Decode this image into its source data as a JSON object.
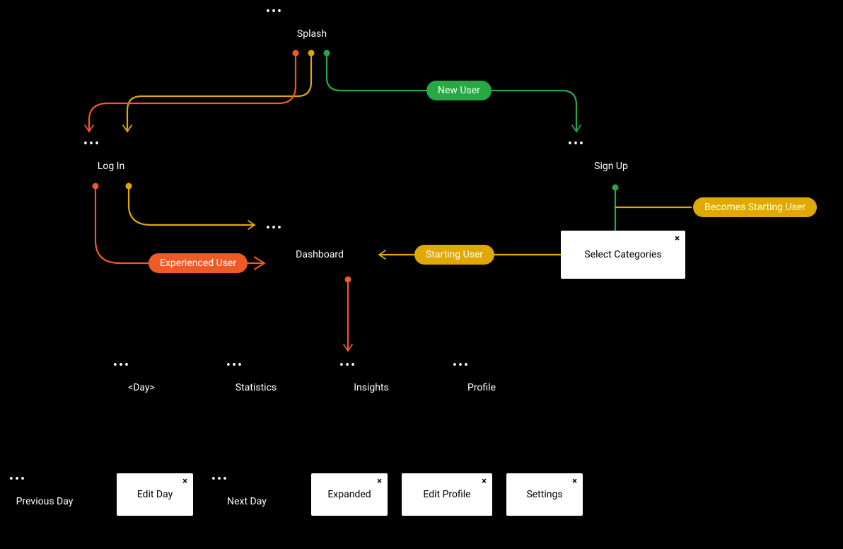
{
  "nodes": {
    "splash": {
      "label": "Splash"
    },
    "login": {
      "label": "Log In"
    },
    "signup": {
      "label": "Sign Up"
    },
    "dashboard": {
      "label": "Dashboard"
    },
    "day": {
      "label": "<Day>"
    },
    "statistics": {
      "label": "Statistics"
    },
    "insights": {
      "label": "Insights"
    },
    "profile": {
      "label": "Profile"
    },
    "previous_day": {
      "label": "Previous Day"
    },
    "next_day": {
      "label": "Next Day"
    }
  },
  "cards": {
    "select_categories": {
      "label": "Select Categories",
      "close": "×"
    },
    "edit_day": {
      "label": "Edit Day",
      "close": "×"
    },
    "expanded": {
      "label": "Expanded",
      "close": "×"
    },
    "edit_profile": {
      "label": "Edit Profile",
      "close": "×"
    },
    "settings": {
      "label": "Settings",
      "close": "×"
    }
  },
  "pills": {
    "new_user": {
      "label": "New User"
    },
    "experienced_user": {
      "label": "Experienced User"
    },
    "starting_user": {
      "label": "Starting User"
    },
    "becomes_starting_user": {
      "label": "Becomes Starting User"
    }
  },
  "ellipsis": "•••",
  "colors": {
    "green": "#28a745",
    "yellow": "#e0a800",
    "orange": "#f05a24"
  },
  "diagram": {
    "description": "App navigation flow. Splash screen branches to Log In (existing/experienced user) and Sign Up (new user). Sign Up leads to Select Categories (user becomes Starting User), then Dashboard. Log In leads to Dashboard (experienced or starting user). Dashboard has child sections: <Day>, Statistics, Insights, Profile. Additional modal/detail screens: Previous Day, Edit Day, Next Day, Expanded, Edit Profile, Settings.",
    "flows": [
      {
        "from": "Splash",
        "to": "Sign Up",
        "label": "New User",
        "color": "green"
      },
      {
        "from": "Splash",
        "to": "Log In",
        "label": null,
        "color": "yellow"
      },
      {
        "from": "Splash",
        "to": "Log In",
        "label": null,
        "color": "orange"
      },
      {
        "from": "Sign Up",
        "to": "Select Categories",
        "label": "Becomes Starting User",
        "color": "yellow"
      },
      {
        "from": "Select Categories",
        "to": "Dashboard",
        "label": "Starting User",
        "color": "yellow"
      },
      {
        "from": "Log In",
        "to": "Dashboard",
        "label": null,
        "color": "yellow"
      },
      {
        "from": "Log In",
        "to": "Dashboard",
        "label": "Experienced User",
        "color": "orange"
      },
      {
        "from": "Dashboard",
        "to": "Insights",
        "label": null,
        "color": "orange"
      }
    ]
  }
}
